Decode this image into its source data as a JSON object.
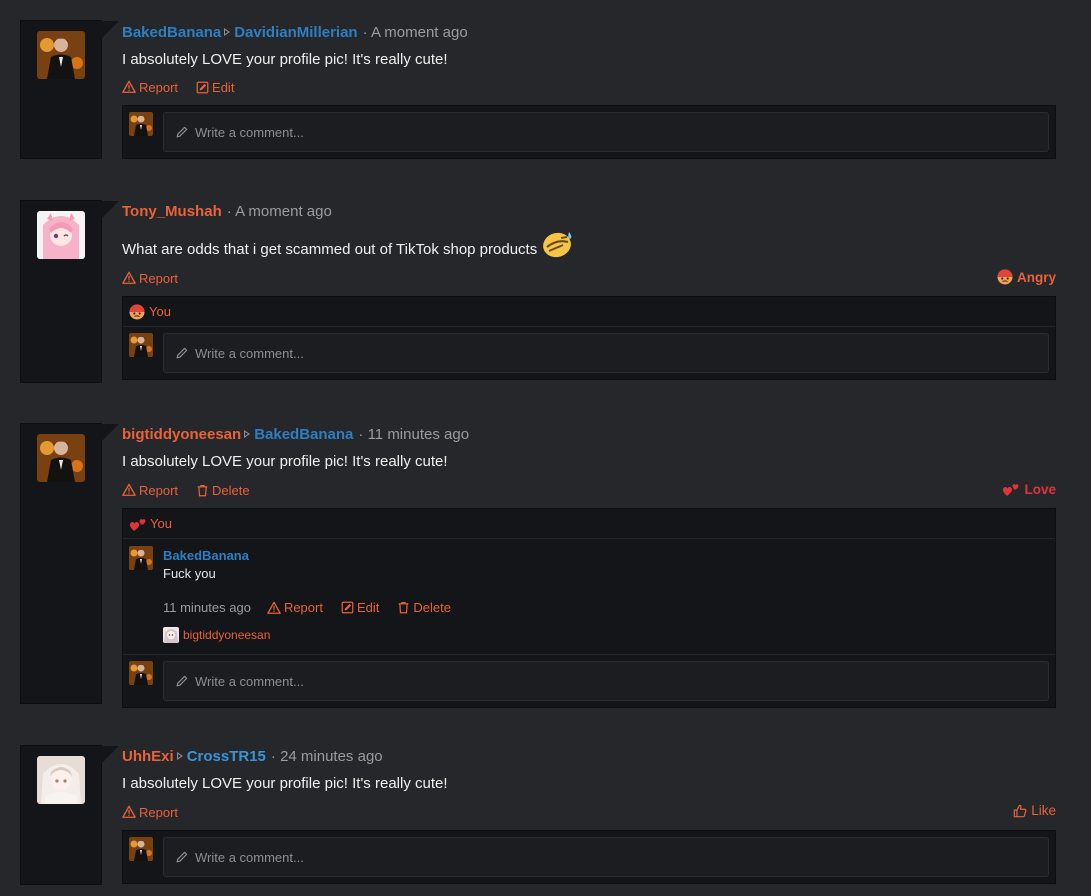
{
  "posts": [
    {
      "author": "BakedBanana",
      "target": "DavidianMillerian",
      "time": "A moment ago",
      "message": "I absolutely LOVE your profile pic! It's really cute!",
      "actions": [
        "Report",
        "Edit"
      ],
      "comment_placeholder": "Write a comment..."
    },
    {
      "author": "Tony_Mushah",
      "time": "A moment ago",
      "message": "What are odds that i get scammed out of TikTok shop products",
      "actions": [
        "Report"
      ],
      "reaction": "Angry",
      "reactors": "You",
      "comment_placeholder": "Write a comment..."
    },
    {
      "author": "bigtiddyoneesan",
      "target": "BakedBanana",
      "time": "11 minutes ago",
      "message": "I absolutely LOVE your profile pic! It's really cute!",
      "actions": [
        "Report",
        "Delete"
      ],
      "reaction": "Love",
      "reactors": "You",
      "reply": {
        "author": "BakedBanana",
        "text": "Fuck you",
        "time": "11 minutes ago",
        "actions": [
          "Report",
          "Edit",
          "Delete"
        ],
        "liker": "bigtiddyoneesan"
      },
      "comment_placeholder": "Write a comment..."
    },
    {
      "author": "UhhExi",
      "target": "CrossTR15",
      "time": "24 minutes ago",
      "message": "I absolutely LOVE your profile pic! It's really cute!",
      "actions": [
        "Report"
      ],
      "reaction": "Like",
      "comment_placeholder": "Write a comment..."
    }
  ],
  "colors": {
    "accent": "#e8623a",
    "username_blue": "#2d7fc3",
    "love_red": "#e0343c",
    "background": "#26272a",
    "panel": "#141518"
  }
}
